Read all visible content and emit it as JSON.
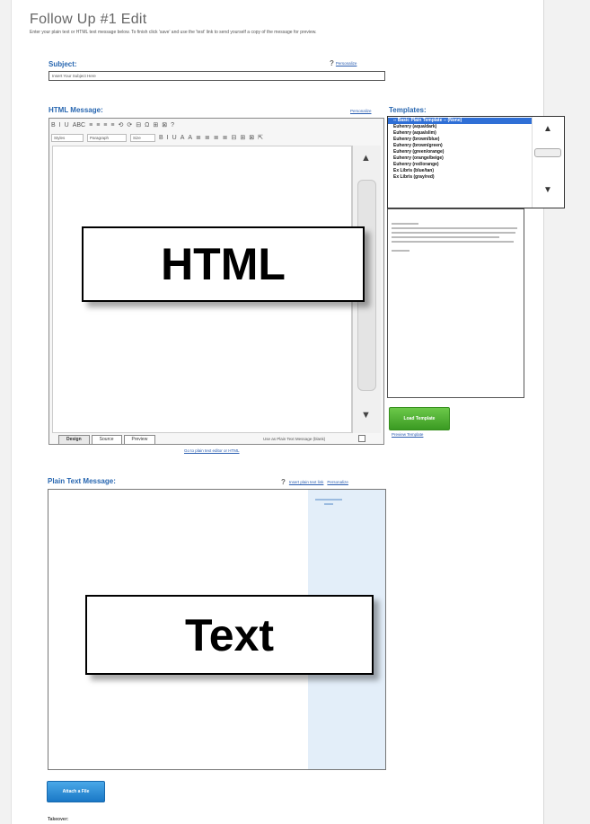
{
  "page": {
    "title": "Follow Up #1 Edit",
    "description": "Enter your plain text or HTML text message below. To finish click 'save' and use the 'test' link to send yourself a copy of the message for preview."
  },
  "subject": {
    "label": "Subject:",
    "help_link": "Personalize",
    "value": "Insert Your Subject Here"
  },
  "html_message": {
    "label": "HTML Message:",
    "help_link": "Personalize",
    "toolbar": {
      "row1": [
        "B",
        "I",
        "U",
        "ABC",
        "≡",
        "≡",
        "≡",
        "≡",
        "⟲",
        "⟳",
        "⊟",
        "Ω",
        "⊞",
        "⊠",
        "?"
      ],
      "style_select": "Styles",
      "format_select": "Paragraph",
      "size_select": "Size",
      "row2": [
        "B",
        "I",
        "U",
        "A",
        "A",
        "≣",
        "≣",
        "≣",
        "≣",
        "⊟",
        "⊞",
        "⊠",
        "⇱"
      ]
    },
    "overlay_label": "HTML",
    "tabs": [
      "Design",
      "Source",
      "Preview"
    ],
    "char_count_label": "Use as Plain Text Message (blank)",
    "below_link": "Go to plain text editor or HTML"
  },
  "templates": {
    "label": "Templates:",
    "items": [
      "-- Basic Plain Template -- (None)",
      "Euhenry (aqua/dark)",
      "Euhenry (aqua/slim)",
      "Euhenry (brown/blue)",
      "Euhenry (brown/green)",
      "Euhenry (green/orange)",
      "Euhenry (orange/beige)",
      "Euhenry (red/orange)",
      "Ex Libris (blue/tan)",
      "Ex Libris (gray/red)"
    ],
    "selected_index": 0,
    "load_button": "Load Template",
    "preview_link": "Preview Template"
  },
  "plain_text": {
    "label": "Plain Text Message:",
    "link_1": "Insert plain text link",
    "link_2": "Personalize",
    "overlay_label": "Text"
  },
  "attach_button": "Attach a File",
  "footer_label": "Takeover:",
  "colors": {
    "accent_blue": "#2766b0",
    "green_button": "#3a9a22",
    "blue_button": "#1a78c6",
    "selection": "#2f6fd6"
  }
}
